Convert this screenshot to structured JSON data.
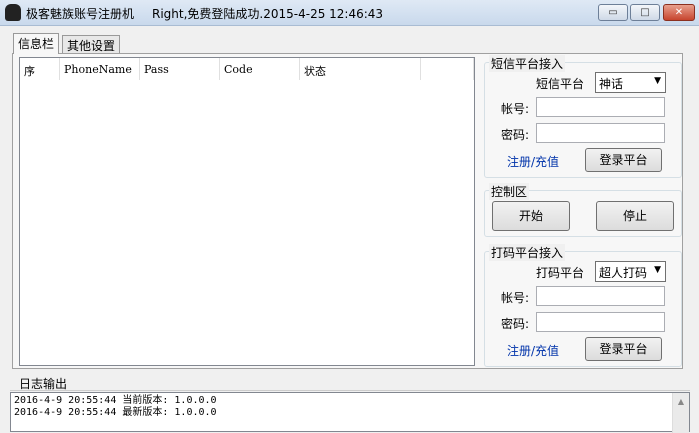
{
  "window": {
    "title": "极客魅族账号注册机",
    "status": "Right,免费登陆成功.2015-4-25 12:46:43"
  },
  "tabs": [
    {
      "label": "信息栏"
    },
    {
      "label": "其他设置"
    }
  ],
  "table": {
    "columns": [
      "序",
      "PhoneName",
      "Pass",
      "Code",
      "状态"
    ],
    "rows": []
  },
  "sms": {
    "title": "短信平台接入",
    "platform_label": "短信平台",
    "platform_value": "神话",
    "account_label": "帐号:",
    "account_value": "",
    "password_label": "密码:",
    "password_value": "",
    "register_link": "注册/充值",
    "login_button": "登录平台"
  },
  "control": {
    "title": "控制区",
    "start": "开始",
    "stop": "停止"
  },
  "captcha": {
    "title": "打码平台接入",
    "platform_label": "打码平台",
    "platform_value": "超人打码",
    "account_label": "帐号:",
    "account_value": "",
    "password_label": "密码:",
    "password_value": "",
    "register_link": "注册/充值",
    "login_button": "登录平台"
  },
  "log": {
    "title": "日志输出",
    "lines": [
      "2016-4-9 20:55:44 当前版本: 1.0.0.0",
      "2016-4-9 20:55:44 最新版本: 1.0.0.0"
    ]
  }
}
